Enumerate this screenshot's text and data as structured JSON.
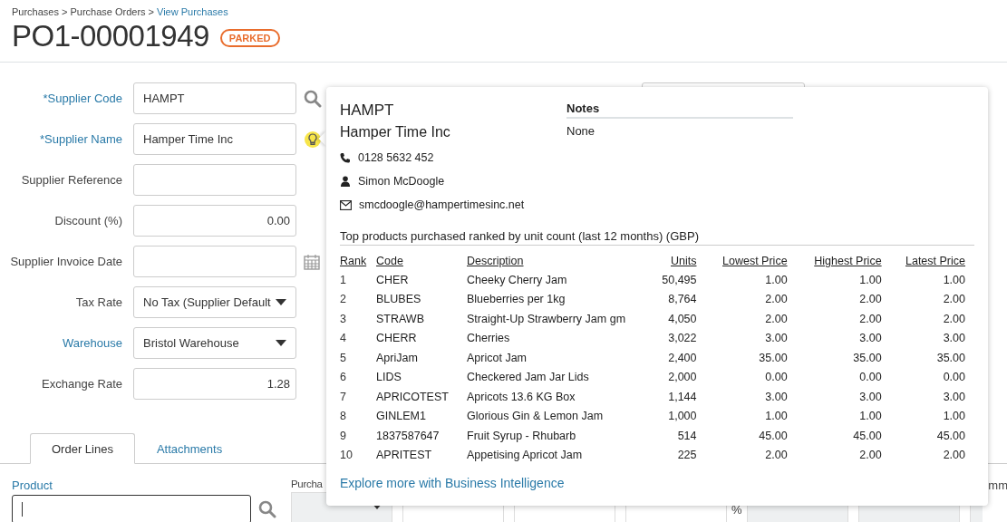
{
  "breadcrumb": [
    "Purchases",
    "Purchase Orders",
    "View Purchases"
  ],
  "breadcrumb_separator": ">",
  "title": "PO1-00001949",
  "status_badge": "PARKED",
  "form_fields": [
    {
      "label": "*Supplier Code",
      "highlighted": true,
      "kind": "search",
      "value": "HAMPT"
    },
    {
      "label": "*Supplier Name",
      "highlighted": true,
      "kind": "lookup",
      "value": "Hamper Time Inc"
    },
    {
      "label": "Supplier Reference",
      "highlighted": false,
      "kind": "text"
    },
    {
      "label": "Discount (%)",
      "highlighted": false,
      "kind": "number",
      "value": "0.00"
    },
    {
      "label": "Supplier Invoice Date",
      "highlighted": false,
      "kind": "date"
    },
    {
      "label": "Tax Rate",
      "highlighted": false,
      "kind": "select",
      "value": "No Tax (Supplier Default"
    },
    {
      "label": "Warehouse",
      "highlighted": true,
      "kind": "select",
      "value": "Bristol Warehouse"
    },
    {
      "label": "Exchange Rate",
      "highlighted": false,
      "kind": "number",
      "value": "1.28"
    }
  ],
  "tabs": [
    {
      "label": "Order Lines",
      "selected": true
    },
    {
      "label": "Attachments",
      "selected": false
    }
  ],
  "order_lines": {
    "product_label": "Product",
    "column_2_label": "Purcha",
    "column_last_label": "mm",
    "percent_sign": "%"
  },
  "popup": {
    "code": "HAMPT",
    "name": "Hamper Time Inc",
    "phone": "0128 5632 452",
    "contact": "Simon McDoogle",
    "email": "smcdoogle@hampertimesinc.net",
    "notes_heading": "Notes",
    "notes": "None",
    "products_heading": "Top products purchased ranked by unit count (last 12 months) (GBP)",
    "columns": [
      "Rank",
      "Code",
      "Description",
      "Units",
      "Lowest Price",
      "Highest Price",
      "Latest Price"
    ],
    "rows": [
      [
        "1",
        "CHER",
        "Cheeky Cherry Jam",
        "50,495",
        "1.00",
        "1.00",
        "1.00"
      ],
      [
        "2",
        "BLUBES",
        "Blueberries per 1kg",
        "8,764",
        "2.00",
        "2.00",
        "2.00"
      ],
      [
        "3",
        "STRAWB",
        "Straight-Up Strawberry Jam gm",
        "4,050",
        "2.00",
        "2.00",
        "2.00"
      ],
      [
        "4",
        "CHERR",
        "Cherries",
        "3,022",
        "3.00",
        "3.00",
        "3.00"
      ],
      [
        "5",
        "ApriJam",
        "Apricot Jam",
        "2,400",
        "35.00",
        "35.00",
        "35.00"
      ],
      [
        "6",
        "LIDS",
        "Checkered Jam Jar Lids",
        "2,000",
        "0.00",
        "0.00",
        "0.00"
      ],
      [
        "7",
        "APRICOTEST",
        "Apricots 13.6 KG Box",
        "1,144",
        "3.00",
        "3.00",
        "3.00"
      ],
      [
        "8",
        "GINLEM1",
        "Glorious Gin & Lemon Jam",
        "1,000",
        "1.00",
        "1.00",
        "1.00"
      ],
      [
        "9",
        "1837587647",
        "Fruit Syrup - Rhubarb",
        "514",
        "45.00",
        "45.00",
        "45.00"
      ],
      [
        "10",
        "APRITEST",
        "Appetising Apricot Jam",
        "225",
        "2.00",
        "2.00",
        "2.00"
      ]
    ],
    "link": "Explore more with Business Intelligence"
  }
}
